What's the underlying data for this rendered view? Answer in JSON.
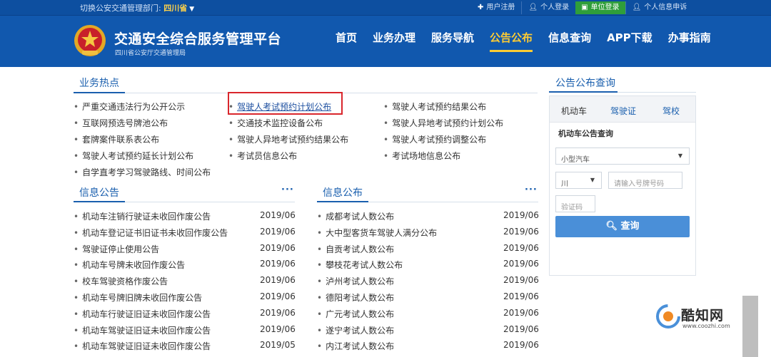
{
  "topbar": {
    "switch_label": "切换公安交通管理部门: ",
    "province": "四川省",
    "links": [
      {
        "icon": "plus-icon",
        "label": "用户注册"
      },
      {
        "icon": "user-icon",
        "label": "个人登录"
      },
      {
        "icon": "building-icon",
        "label": "单位登录"
      },
      {
        "icon": "user-icon",
        "label": "个人信息申诉"
      }
    ]
  },
  "header": {
    "title": "交通安全综合服务管理平台",
    "subtitle": "四川省公安厅交通管理局",
    "nav": [
      "首页",
      "业务办理",
      "服务导航",
      "公告公布",
      "信息查询",
      "APP下载",
      "办事指南"
    ],
    "active_nav": "公告公布"
  },
  "hot": {
    "title": "业务热点",
    "items": [
      "严重交通违法行为公开公示",
      "驾驶人考试预约计划公布",
      "驾驶人考试预约结果公布",
      "互联网预选号牌池公布",
      "交通技术监控设备公布",
      "驾驶人异地考试预约计划公布",
      "套牌案件联系表公布",
      "驾驶人异地考试预约结果公布",
      "驾驶人考试预约调整公布",
      "驾驶人考试预约延长计划公布",
      "考试员信息公布",
      "考试场地信息公布",
      "自学直考学习驾驶路线、时间公布"
    ]
  },
  "info_notice": {
    "title": "信息公告",
    "more": "···",
    "items": [
      {
        "label": "机动车注销行驶证未收回作废公告",
        "date": "2019/06"
      },
      {
        "label": "机动车登记证书旧证书未收回作废公告",
        "date": "2019/06"
      },
      {
        "label": "驾驶证停止使用公告",
        "date": "2019/06"
      },
      {
        "label": "机动车号牌未收回作废公告",
        "date": "2019/06"
      },
      {
        "label": "校车驾驶资格作废公告",
        "date": "2019/06"
      },
      {
        "label": "机动车号牌旧牌未收回作废公告",
        "date": "2019/06"
      },
      {
        "label": "机动车行驶证旧证未收回作废公告",
        "date": "2019/06"
      },
      {
        "label": "机动车驾驶证旧证未收回作废公告",
        "date": "2019/06"
      },
      {
        "label": "机动车驾驶证旧证未收回作废公告",
        "date": "2019/05"
      }
    ]
  },
  "info_publish": {
    "title": "信息公布",
    "more": "···",
    "items": [
      {
        "label": "成都考试人数公布",
        "date": "2019/06"
      },
      {
        "label": "大中型客货车驾驶人满分公布",
        "date": "2019/06"
      },
      {
        "label": "自贡考试人数公布",
        "date": "2019/06"
      },
      {
        "label": "攀枝花考试人数公布",
        "date": "2019/06"
      },
      {
        "label": "泸州考试人数公布",
        "date": "2019/06"
      },
      {
        "label": "德阳考试人数公布",
        "date": "2019/06"
      },
      {
        "label": "广元考试人数公布",
        "date": "2019/06"
      },
      {
        "label": "遂宁考试人数公布",
        "date": "2019/06"
      },
      {
        "label": "内江考试人数公布",
        "date": "2019/06"
      }
    ]
  },
  "query": {
    "title": "公告公布查询",
    "tabs": [
      "机动车",
      "驾驶证",
      "驾校"
    ],
    "subtitle": "机动车公告查询",
    "vehicle_type": "小型汽车",
    "province_prefix": "川",
    "plate_placeholder": "请输入号牌号码",
    "captcha_placeholder": "验证码",
    "button": "查询"
  },
  "watermark": {
    "name": "酷知网",
    "url": "www.coozhi.com"
  },
  "colors": {
    "primary": "#1158ae",
    "accent": "#ffcc33",
    "highlight": "#d9262c",
    "button": "#4a8fd8",
    "login_green": "#2f9e3a"
  }
}
